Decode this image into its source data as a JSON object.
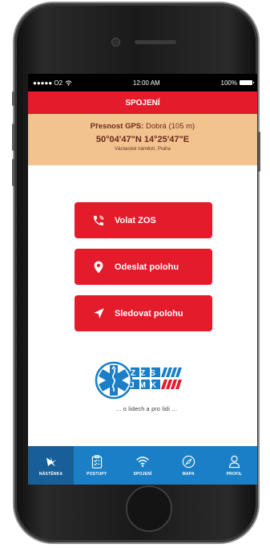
{
  "status_bar": {
    "carrier": "●●●●● O2",
    "time": "12:00 AM",
    "battery": "100%"
  },
  "header": {
    "title": "SPOJENÍ"
  },
  "gps": {
    "accuracy_label": "Přesnost GPS:",
    "accuracy_value": "Dobrá (105 m)",
    "coordinates": "50°04'47\"N 14°25'47\"E",
    "place": "Václavské náměstí, Praha"
  },
  "actions": [
    {
      "label": "Volat ZOS",
      "icon": "phone-icon"
    },
    {
      "label": "Odeslat polohu",
      "icon": "map-pin-icon"
    },
    {
      "label": "Sledovat polohu",
      "icon": "navigation-arrow-icon"
    }
  ],
  "logo": {
    "text_top": "ZZS",
    "text_bottom": "JMK",
    "tagline": "... o lidech a pro lidi ..."
  },
  "tabs": [
    {
      "label": "NÁSTĚNKA",
      "icon": "star-of-life-icon"
    },
    {
      "label": "POSTUPY",
      "icon": "clipboard-icon"
    },
    {
      "label": "SPOJENÍ",
      "icon": "wifi-icon"
    },
    {
      "label": "MAPA",
      "icon": "compass-icon"
    },
    {
      "label": "PROFIL",
      "icon": "user-icon"
    }
  ],
  "colors": {
    "accent": "#e31b2b",
    "gps_panel": "#f2c38e",
    "tabbar": "#1a7fc6"
  }
}
